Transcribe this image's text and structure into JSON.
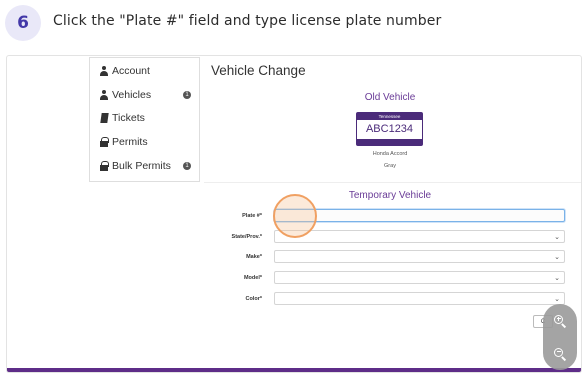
{
  "step": {
    "number": "6",
    "instruction": "Click the \"Plate #\" field and type license plate number"
  },
  "sidebar": {
    "items": [
      {
        "label": "Account",
        "icon": "person-icon",
        "badge": ""
      },
      {
        "label": "Vehicles",
        "icon": "person-icon",
        "badge": "1"
      },
      {
        "label": "Tickets",
        "icon": "ticket-icon",
        "badge": ""
      },
      {
        "label": "Permits",
        "icon": "lock-icon",
        "badge": ""
      },
      {
        "label": "Bulk Permits",
        "icon": "lock-icon",
        "badge": "1"
      }
    ]
  },
  "main": {
    "title": "Vehicle Change",
    "old_vehicle": {
      "heading": "Old Vehicle",
      "plate_state": "Tennessee",
      "plate_number": "ABC1234",
      "model": "Honda Accord",
      "color": "Gray"
    },
    "temp_vehicle": {
      "heading": "Temporary Vehicle",
      "fields": [
        {
          "label": "Plate #",
          "type": "text",
          "value": ""
        },
        {
          "label": "State/Prov.",
          "type": "select",
          "value": ""
        },
        {
          "label": "Make",
          "type": "select",
          "value": ""
        },
        {
          "label": "Model",
          "type": "select",
          "value": ""
        },
        {
          "label": "Color",
          "type": "select",
          "value": ""
        }
      ],
      "cancel_label": "C"
    }
  },
  "zoom": {
    "in_icon": "zoom-in-icon",
    "out_icon": "zoom-out-icon"
  },
  "colors": {
    "accent_purple": "#5e2d88",
    "click_highlight": "#f0a062",
    "step_badge_bg": "#e9e8f8",
    "step_badge_fg": "#4338a8"
  }
}
